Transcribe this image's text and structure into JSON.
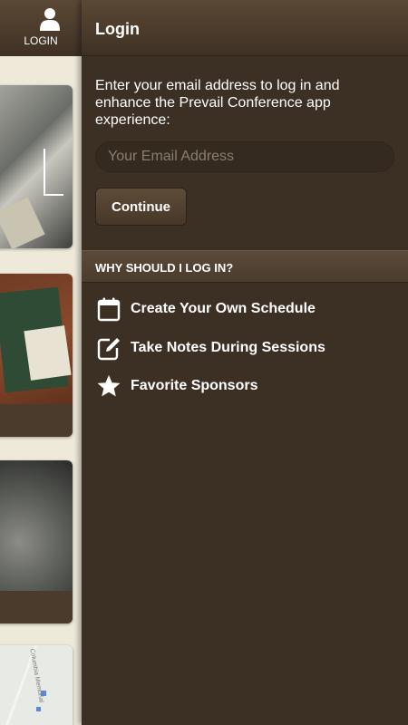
{
  "background_app": {
    "login_tab_label": "LOGIN",
    "map_text": "Columbia Memorial"
  },
  "panel": {
    "title": "Login",
    "intro": "Enter your email address to log in and enhance the Prevail Conference app experience:",
    "email_placeholder": "Your Email Address",
    "email_value": "",
    "continue_label": "Continue",
    "why_header": "WHY SHOULD I LOG IN?",
    "benefits": [
      {
        "icon": "calendar-icon",
        "label": "Create Your Own Schedule"
      },
      {
        "icon": "edit-note-icon",
        "label": "Take Notes During Sessions"
      },
      {
        "icon": "star-icon",
        "label": "Favorite Sponsors"
      }
    ]
  },
  "colors": {
    "panel_bg": "#3c3024",
    "header_bg": "#4e3e2d",
    "background_app_bg": "#efe9da",
    "text": "#ffffff"
  }
}
